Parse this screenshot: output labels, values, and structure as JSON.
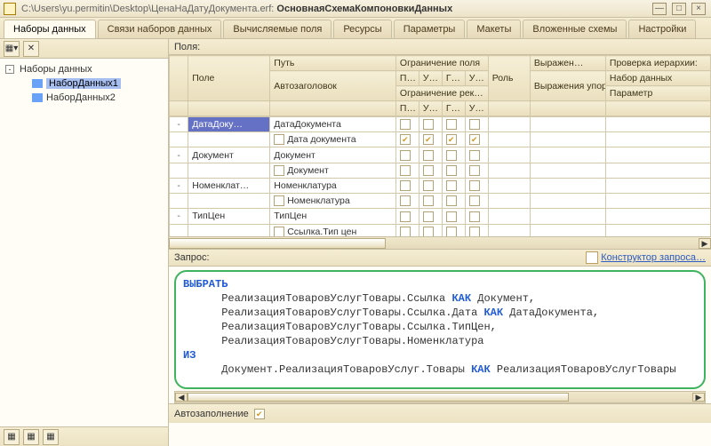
{
  "title": {
    "prefix": "C:\\Users\\yu.permitin\\Desktop\\ЦенаНаДатуДокумента.erf: ",
    "main": "ОсновнаяСхемаКомпоновкиДанных"
  },
  "tabs": [
    "Наборы данных",
    "Связи наборов данных",
    "Вычисляемые поля",
    "Ресурсы",
    "Параметры",
    "Макеты",
    "Вложенные схемы",
    "Настройки"
  ],
  "tree": {
    "root": "Наборы данных",
    "items": [
      "НаборДанных1",
      "НаборДанных2"
    ]
  },
  "fields_label": "Поля:",
  "grid": {
    "headers": {
      "pole": "Поле",
      "put": "Путь",
      "autoheader": "Автозаголовок",
      "ogr_polya": "Ограничение поля",
      "ogr_rek": "Ограничение рек…",
      "rol": "Роль",
      "vyrazh": "Выражен…",
      "vyrazh_up": "Выражения упорядочив…",
      "proverka": "Проверка иерархии:",
      "nabor": "Набор данных",
      "parametr": "Параметр",
      "p": "П…",
      "u": "У…",
      "g": "Г…",
      "u2": "У…"
    },
    "rows": [
      {
        "field": "ДатаДоку…",
        "path": "ДатаДокумента",
        "auto": "Дата документа",
        "chk_top": [
          0,
          0,
          0,
          0
        ],
        "chk_bot": [
          1,
          1,
          1,
          1
        ]
      },
      {
        "field": "Документ",
        "path": "Документ",
        "auto": "Документ",
        "chk_top": [
          0,
          0,
          0,
          0
        ],
        "chk_bot": [
          0,
          0,
          0,
          0
        ]
      },
      {
        "field": "Номенклат…",
        "path": "Номенклатура",
        "auto": "Номенклатура",
        "chk_top": [
          0,
          0,
          0,
          0
        ],
        "chk_bot": [
          0,
          0,
          0,
          0
        ]
      },
      {
        "field": "ТипЦен",
        "path": "ТипЦен",
        "auto": "Ссылка.Тип цен",
        "chk_top": [
          0,
          0,
          0,
          0
        ],
        "chk_bot": [
          0,
          0,
          0,
          0
        ]
      }
    ]
  },
  "query": {
    "label": "Запрос:",
    "constructor_link": "Конструктор запроса…",
    "kw_select": "ВЫБРАТЬ",
    "kw_as": "КАК",
    "kw_from": "ИЗ",
    "sel1a": "РеализацияТоваровУслугТовары.Ссылка ",
    "sel1b": " Документ,",
    "sel2a": "РеализацияТоваровУслугТовары.Ссылка.Дата ",
    "sel2b": " ДатаДокумента,",
    "sel3": "РеализацияТоваровУслугТовары.Ссылка.ТипЦен,",
    "sel4": "РеализацияТоваровУслугТовары.Номенклатура",
    "from1a": "Документ.РеализацияТоваровУслуг.Товары ",
    "from1b": " РеализацияТоваровУслугТовары"
  },
  "autofill": {
    "label": "Автозаполнение",
    "checked": true
  }
}
